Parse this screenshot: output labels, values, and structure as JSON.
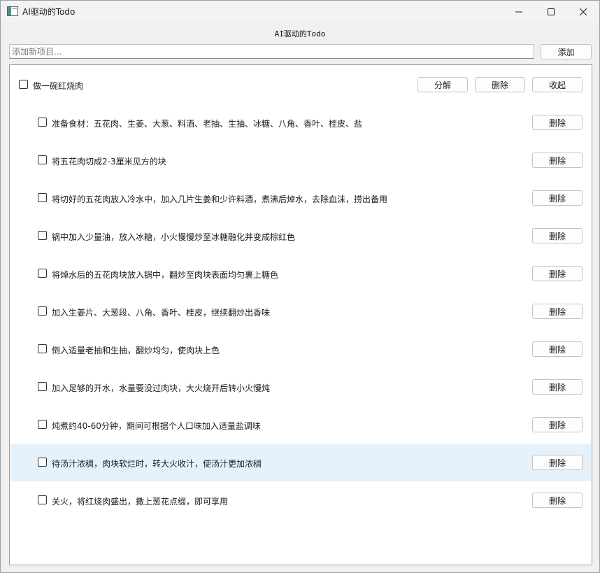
{
  "window": {
    "title": "AI驱动的Todo"
  },
  "content_title": "AI驱动的Todo",
  "new_item": {
    "placeholder": "添加新项目...",
    "value": "",
    "add_label": "添加"
  },
  "parent_task": {
    "label": "做一碗红烧肉",
    "checked": false,
    "decompose_label": "分解",
    "delete_label": "删除",
    "collapse_label": "收起"
  },
  "subtask_delete_label": "删除",
  "subtasks": [
    {
      "label": "准备食材：五花肉、生姜、大葱、料酒、老抽、生抽、冰糖、八角、香叶、桂皮、盐",
      "checked": false,
      "highlighted": false
    },
    {
      "label": "将五花肉切成2-3厘米见方的块",
      "checked": false,
      "highlighted": false
    },
    {
      "label": "将切好的五花肉放入冷水中，加入几片生姜和少许料酒，煮沸后焯水，去除血沫，捞出备用",
      "checked": false,
      "highlighted": false
    },
    {
      "label": "锅中加入少量油，放入冰糖，小火慢慢炒至冰糖融化并变成棕红色",
      "checked": false,
      "highlighted": false
    },
    {
      "label": "将焯水后的五花肉块放入锅中，翻炒至肉块表面均匀裹上糖色",
      "checked": false,
      "highlighted": false
    },
    {
      "label": "加入生姜片、大葱段、八角、香叶、桂皮，继续翻炒出香味",
      "checked": false,
      "highlighted": false
    },
    {
      "label": "倒入适量老抽和生抽，翻炒均匀，使肉块上色",
      "checked": false,
      "highlighted": false
    },
    {
      "label": "加入足够的开水，水量要没过肉块，大火烧开后转小火慢炖",
      "checked": false,
      "highlighted": false
    },
    {
      "label": "炖煮约40-60分钟，期间可根据个人口味加入适量盐调味",
      "checked": false,
      "highlighted": false
    },
    {
      "label": "待汤汁浓稠，肉块软烂时，转大火收汁，使汤汁更加浓稠",
      "checked": false,
      "highlighted": true
    },
    {
      "label": "关火，将红烧肉盛出，撒上葱花点缀，即可享用",
      "checked": false,
      "highlighted": false
    }
  ]
}
